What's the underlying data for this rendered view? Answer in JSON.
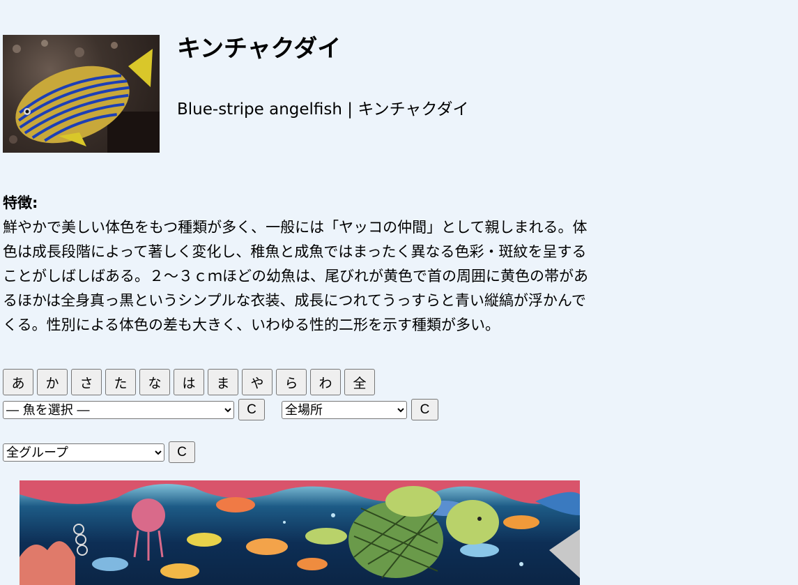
{
  "fish": {
    "title": "キンチャクダイ",
    "subtitle": "Blue-stripe angelfish | キンチャクダイ"
  },
  "features": {
    "label": "特徴:",
    "text": "鮮やかで美しい体色をもつ種類が多く、一般には「ヤッコの仲間」として親しまれる。体色は成長段階によって著しく変化し、稚魚と成魚ではまったく異なる色彩・斑紋を呈することがしばしばある。２～３ｃｍほどの幼魚は、尾びれが黄色で首の周囲に黄色の帯があるほかは全身真っ黒というシンプルな衣装、成長につれてうっすらと青い縦縞が浮かんでくる。性別による体色の差も大きく、いわゆる性的二形を示す種類が多い。"
  },
  "kana_buttons": [
    "あ",
    "か",
    "さ",
    "た",
    "な",
    "は",
    "ま",
    "や",
    "ら",
    "わ",
    "全"
  ],
  "filters": {
    "fish_select": "― 魚を選択 ―",
    "place_select": "全場所",
    "group_select": "全グループ",
    "clear_label": "C"
  },
  "colors": {
    "background": "#edf4fb"
  }
}
